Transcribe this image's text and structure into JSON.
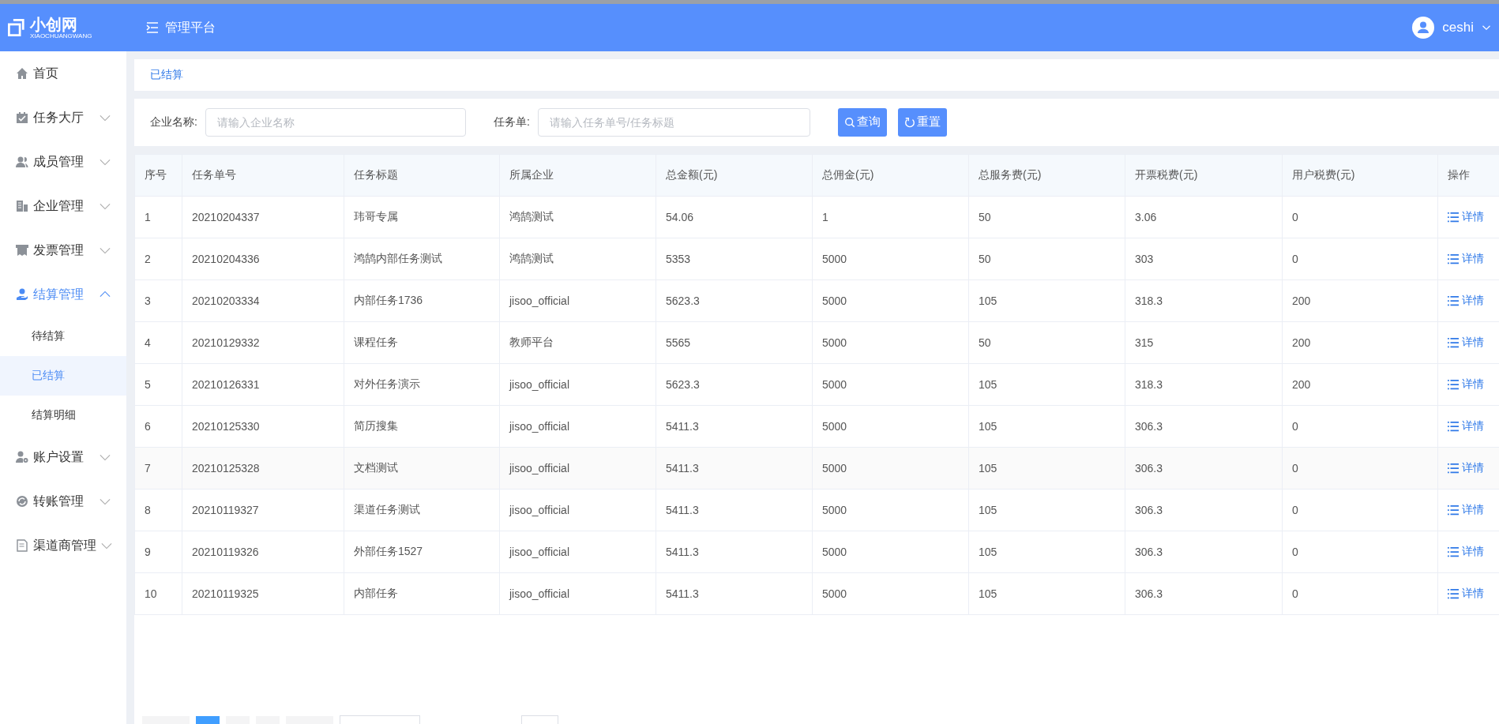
{
  "header": {
    "logo_text": "小创网",
    "logo_subtext": "XIAOCHUANGWANG",
    "title": "管理平台",
    "user": "ceshi"
  },
  "sidebar": {
    "items": [
      {
        "label": "首页",
        "selected": false
      },
      {
        "label": "任务大厅",
        "expanded": false,
        "selected": false
      },
      {
        "label": "成员管理",
        "expanded": false,
        "selected": false
      },
      {
        "label": "企业管理",
        "expanded": false,
        "selected": false
      },
      {
        "label": "发票管理",
        "expanded": false,
        "selected": false
      },
      {
        "label": "结算管理",
        "expanded": true,
        "selected": true,
        "children": [
          {
            "label": "待结算",
            "selected": false
          },
          {
            "label": "已结算",
            "selected": true
          },
          {
            "label": "结算明细",
            "selected": false
          }
        ]
      },
      {
        "label": "账户设置",
        "expanded": false,
        "selected": false
      },
      {
        "label": "转账管理",
        "expanded": false,
        "selected": false
      },
      {
        "label": "渠道商管理",
        "expanded": false,
        "selected": false
      }
    ]
  },
  "breadcrumb": "已结算",
  "search": {
    "fields": [
      {
        "label": "企业名称:",
        "placeholder": "请输入企业名称"
      },
      {
        "label": "任务单:",
        "placeholder": "请输入任务单号/任务标题"
      }
    ],
    "buttons": [
      {
        "kind": "search",
        "label": "查询"
      },
      {
        "kind": "reset",
        "label": "重置"
      }
    ]
  },
  "table": {
    "columns": [
      "序号",
      "任务单号",
      "任务标题",
      "所属企业",
      "总金额(元)",
      "总佣金(元)",
      "总服务费(元)",
      "开票税费(元)",
      "用户税费(元)",
      "操作"
    ],
    "rows": [
      [
        "1",
        "20210204337",
        "玮哥专属",
        "鸿鹄测试",
        "54.06",
        "1",
        "50",
        "3.06",
        "0",
        "详情"
      ],
      [
        "2",
        "20210204336",
        "鸿鹄内部任务测试",
        "鸿鹄测试",
        "5353",
        "5000",
        "50",
        "303",
        "0",
        "详情"
      ],
      [
        "3",
        "20210203334",
        "内部任务1736",
        "jisoo_official",
        "5623.3",
        "5000",
        "105",
        "318.3",
        "200",
        "详情"
      ],
      [
        "4",
        "20210129332",
        "课程任务",
        "教师平台",
        "5565",
        "5000",
        "50",
        "315",
        "200",
        "详情"
      ],
      [
        "5",
        "20210126331",
        "对外任务演示",
        "jisoo_official",
        "5623.3",
        "5000",
        "105",
        "318.3",
        "200",
        "详情"
      ],
      [
        "6",
        "20210125330",
        "简历搜集",
        "jisoo_official",
        "5411.3",
        "5000",
        "105",
        "306.3",
        "0",
        "详情"
      ],
      [
        "7",
        "20210125328",
        "文档测试",
        "jisoo_official",
        "5411.3",
        "5000",
        "105",
        "306.3",
        "0",
        "详情"
      ],
      [
        "8",
        "20210119327",
        "渠道任务测试",
        "jisoo_official",
        "5411.3",
        "5000",
        "105",
        "306.3",
        "0",
        "详情"
      ],
      [
        "9",
        "20210119326",
        "外部任务1527",
        "jisoo_official",
        "5411.3",
        "5000",
        "105",
        "306.3",
        "0",
        "详情"
      ],
      [
        "10",
        "20210119325",
        "内部任务",
        "jisoo_official",
        "5411.3",
        "5000",
        "105",
        "306.3",
        "0",
        "详情"
      ]
    ]
  },
  "pagination": [
    {
      "kind": "wide"
    },
    {
      "kind": "page",
      "selected": true
    },
    {
      "kind": "page",
      "selected": false
    },
    {
      "kind": "page",
      "selected": false
    },
    {
      "kind": "wide"
    },
    {
      "kind": "select"
    },
    {
      "kind": "input"
    }
  ]
}
